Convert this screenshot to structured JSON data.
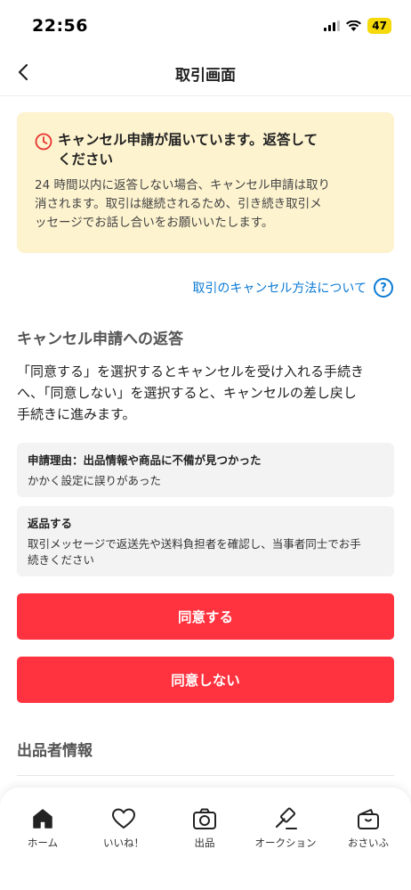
{
  "status_bar": {
    "time": "22:56",
    "battery": "47"
  },
  "nav": {
    "title": "取引画面"
  },
  "alert": {
    "title_line1": "キャンセル申請が届いています。返答して",
    "title_line2": "ください",
    "body_line1": "24 時間以内に返答しない場合、キャンセル申請は取り",
    "body_line2": "消されます。取引は継続されるため、引き続き取引メ",
    "body_line3": "ッセージでお話し合いをお願いいたします。"
  },
  "help_link": {
    "label": "取引のキャンセル方法について",
    "icon_glyph": "?"
  },
  "section": {
    "title": "キャンセル申請への返答",
    "desc_line1": "「同意する」を選択するとキャンセルを受け入れる手続き",
    "desc_line2": "へ、「同意しない」を選択すると、キャンセルの差し戻し",
    "desc_line3": "手続きに進みます。"
  },
  "reason": {
    "label": "申請理由：出品情報や商品に不備が見つかった",
    "value": "かかく設定に誤りがあった"
  },
  "return": {
    "label": "返品する",
    "value_line1": "取引メッセージで返送先や送料負担者を確認し、当事者同士でお手",
    "value_line2": "続きください"
  },
  "buttons": {
    "agree": "同意する",
    "disagree": "同意しない"
  },
  "seller": {
    "title": "出品者情報"
  },
  "tabs": [
    {
      "label": "ホーム",
      "icon": "home-icon"
    },
    {
      "label": "いいね！",
      "icon": "heart-icon"
    },
    {
      "label": "出品",
      "icon": "camera-icon"
    },
    {
      "label": "オークション",
      "icon": "gavel-icon"
    },
    {
      "label": "おさいふ",
      "icon": "wallet-icon"
    }
  ],
  "colors": {
    "accent_red": "#ff333f",
    "link_blue": "#0b7ad4",
    "alert_bg": "#fdf3cf",
    "alert_icon": "#e8322d"
  }
}
